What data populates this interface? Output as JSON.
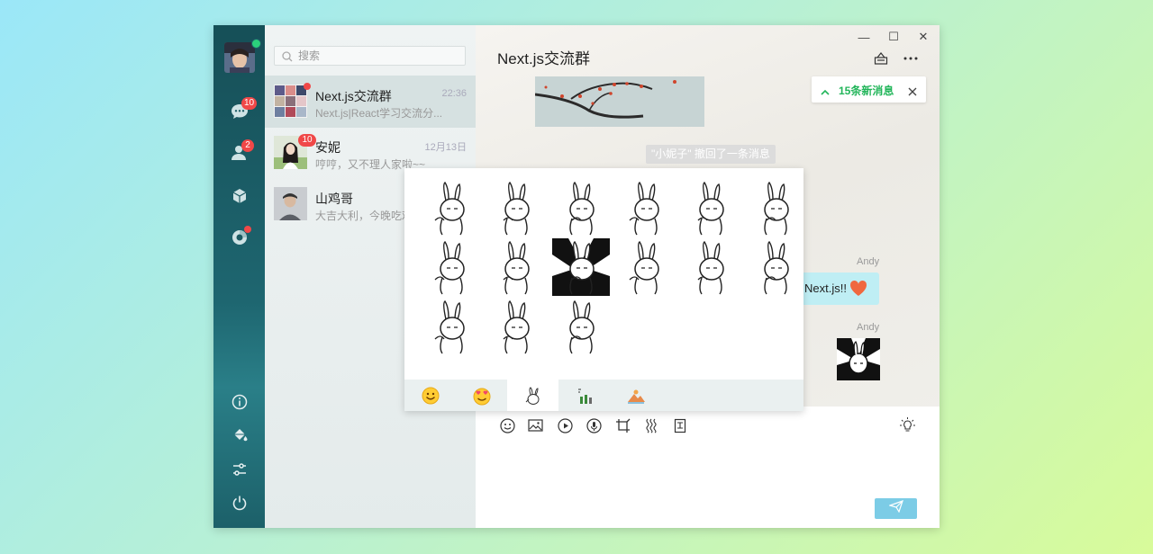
{
  "window": {
    "controls": [
      "—",
      "☐",
      "✕"
    ]
  },
  "rail": {
    "chat_badge": "10",
    "contacts_badge": "2"
  },
  "search": {
    "placeholder": "搜索"
  },
  "conversations": [
    {
      "name": "Next.js交流群",
      "time": "22:36",
      "preview": "Next.js|React学习交流分...",
      "unread_dot": true
    },
    {
      "name": "安妮",
      "time": "12月13日",
      "preview": "哼哼，又不理人家啦~~",
      "badge": "10"
    },
    {
      "name": "山鸡哥",
      "time": "",
      "preview": "大吉大利，今晚吃鸡"
    }
  ],
  "chat": {
    "title": "Next.js交流群",
    "new_messages": "15条新消息",
    "recall_notice": "\"小妮子\" 撤回了一条消息",
    "messages": [
      {
        "sender": "Andy",
        "text": "Next.js!! "
      },
      {
        "sender": "Andy",
        "type": "sticker"
      }
    ]
  },
  "sticker_panel": {
    "tabs": [
      "emoji-smile",
      "emoji-heart-eyes",
      "rabbit-stickers",
      "bottles-stickers",
      "landscape-stickers"
    ],
    "active_tab": 2,
    "sticker_count": 15
  },
  "toolbar": {
    "icons": [
      "smiley-icon",
      "image-icon",
      "video-icon",
      "mic-icon",
      "crop-icon",
      "shake-icon",
      "file-icon",
      "bulb-icon"
    ]
  },
  "colors": {
    "accent": "#22b55a",
    "rail": "#1a5b63",
    "badge": "#f04848",
    "send": "#7ccce6",
    "bubble": "#bfeef4"
  }
}
